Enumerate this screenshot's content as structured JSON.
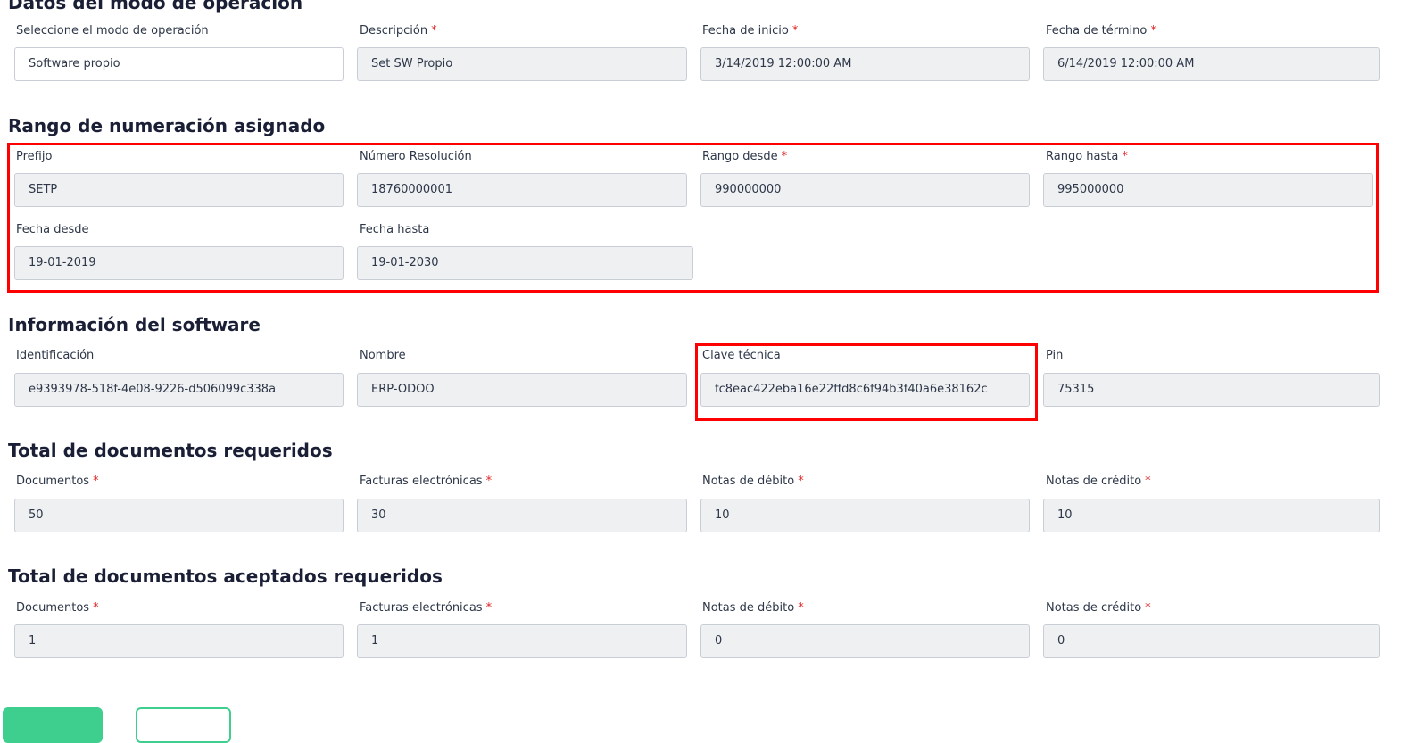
{
  "sections": {
    "modo": {
      "title": "Datos del modo de operación",
      "fields": [
        {
          "label": "Seleccione el modo de operación",
          "required": "",
          "value": "Software propio"
        },
        {
          "label": "Descripción",
          "required": "*",
          "value": "Set SW Propio"
        },
        {
          "label": "Fecha de inicio",
          "required": "*",
          "value": "3/14/2019 12:00:00 AM"
        },
        {
          "label": "Fecha de término",
          "required": "*",
          "value": "6/14/2019 12:00:00 AM"
        }
      ]
    },
    "rango": {
      "title": "Rango de numeración asignado",
      "fields": [
        {
          "label": "Prefijo",
          "required": "",
          "value": "SETP"
        },
        {
          "label": "Número Resolución",
          "required": "",
          "value": "18760000001"
        },
        {
          "label": "Rango desde",
          "required": "*",
          "value": "990000000"
        },
        {
          "label": "Rango hasta",
          "required": "*",
          "value": "995000000"
        },
        {
          "label": "Fecha desde",
          "required": "",
          "value": "19-01-2019"
        },
        {
          "label": "Fecha hasta",
          "required": "",
          "value": "19-01-2030"
        }
      ]
    },
    "software": {
      "title": "Información del software",
      "fields": [
        {
          "label": "Identificación",
          "required": "",
          "value": "e9393978-518f-4e08-9226-d506099c338a"
        },
        {
          "label": "Nombre",
          "required": "",
          "value": "ERP-ODOO"
        },
        {
          "label": "Clave técnica",
          "required": "",
          "value": "fc8eac422eba16e22ffd8c6f94b3f40a6e38162c"
        },
        {
          "label": "Pin",
          "required": "",
          "value": "75315"
        }
      ]
    },
    "requeridos": {
      "title": "Total de documentos requeridos",
      "fields": [
        {
          "label": "Documentos",
          "required": "*",
          "value": "50"
        },
        {
          "label": "Facturas electrónicas",
          "required": "*",
          "value": "30"
        },
        {
          "label": "Notas de débito",
          "required": "*",
          "value": "10"
        },
        {
          "label": "Notas de crédito",
          "required": "*",
          "value": "10"
        }
      ]
    },
    "aceptados": {
      "title": "Total de documentos aceptados requeridos",
      "fields": [
        {
          "label": "Documentos",
          "required": "*",
          "value": "1"
        },
        {
          "label": "Facturas electrónicas",
          "required": "*",
          "value": "1"
        },
        {
          "label": "Notas de débito",
          "required": "*",
          "value": "0"
        },
        {
          "label": "Notas de crédito",
          "required": "*",
          "value": "0"
        }
      ]
    }
  },
  "colors": {
    "accent": "#3ecf8e",
    "highlight": "#ff0000",
    "required": "#e02424",
    "heading": "#1a1f36",
    "input_disabled_bg": "#eff0f2"
  }
}
